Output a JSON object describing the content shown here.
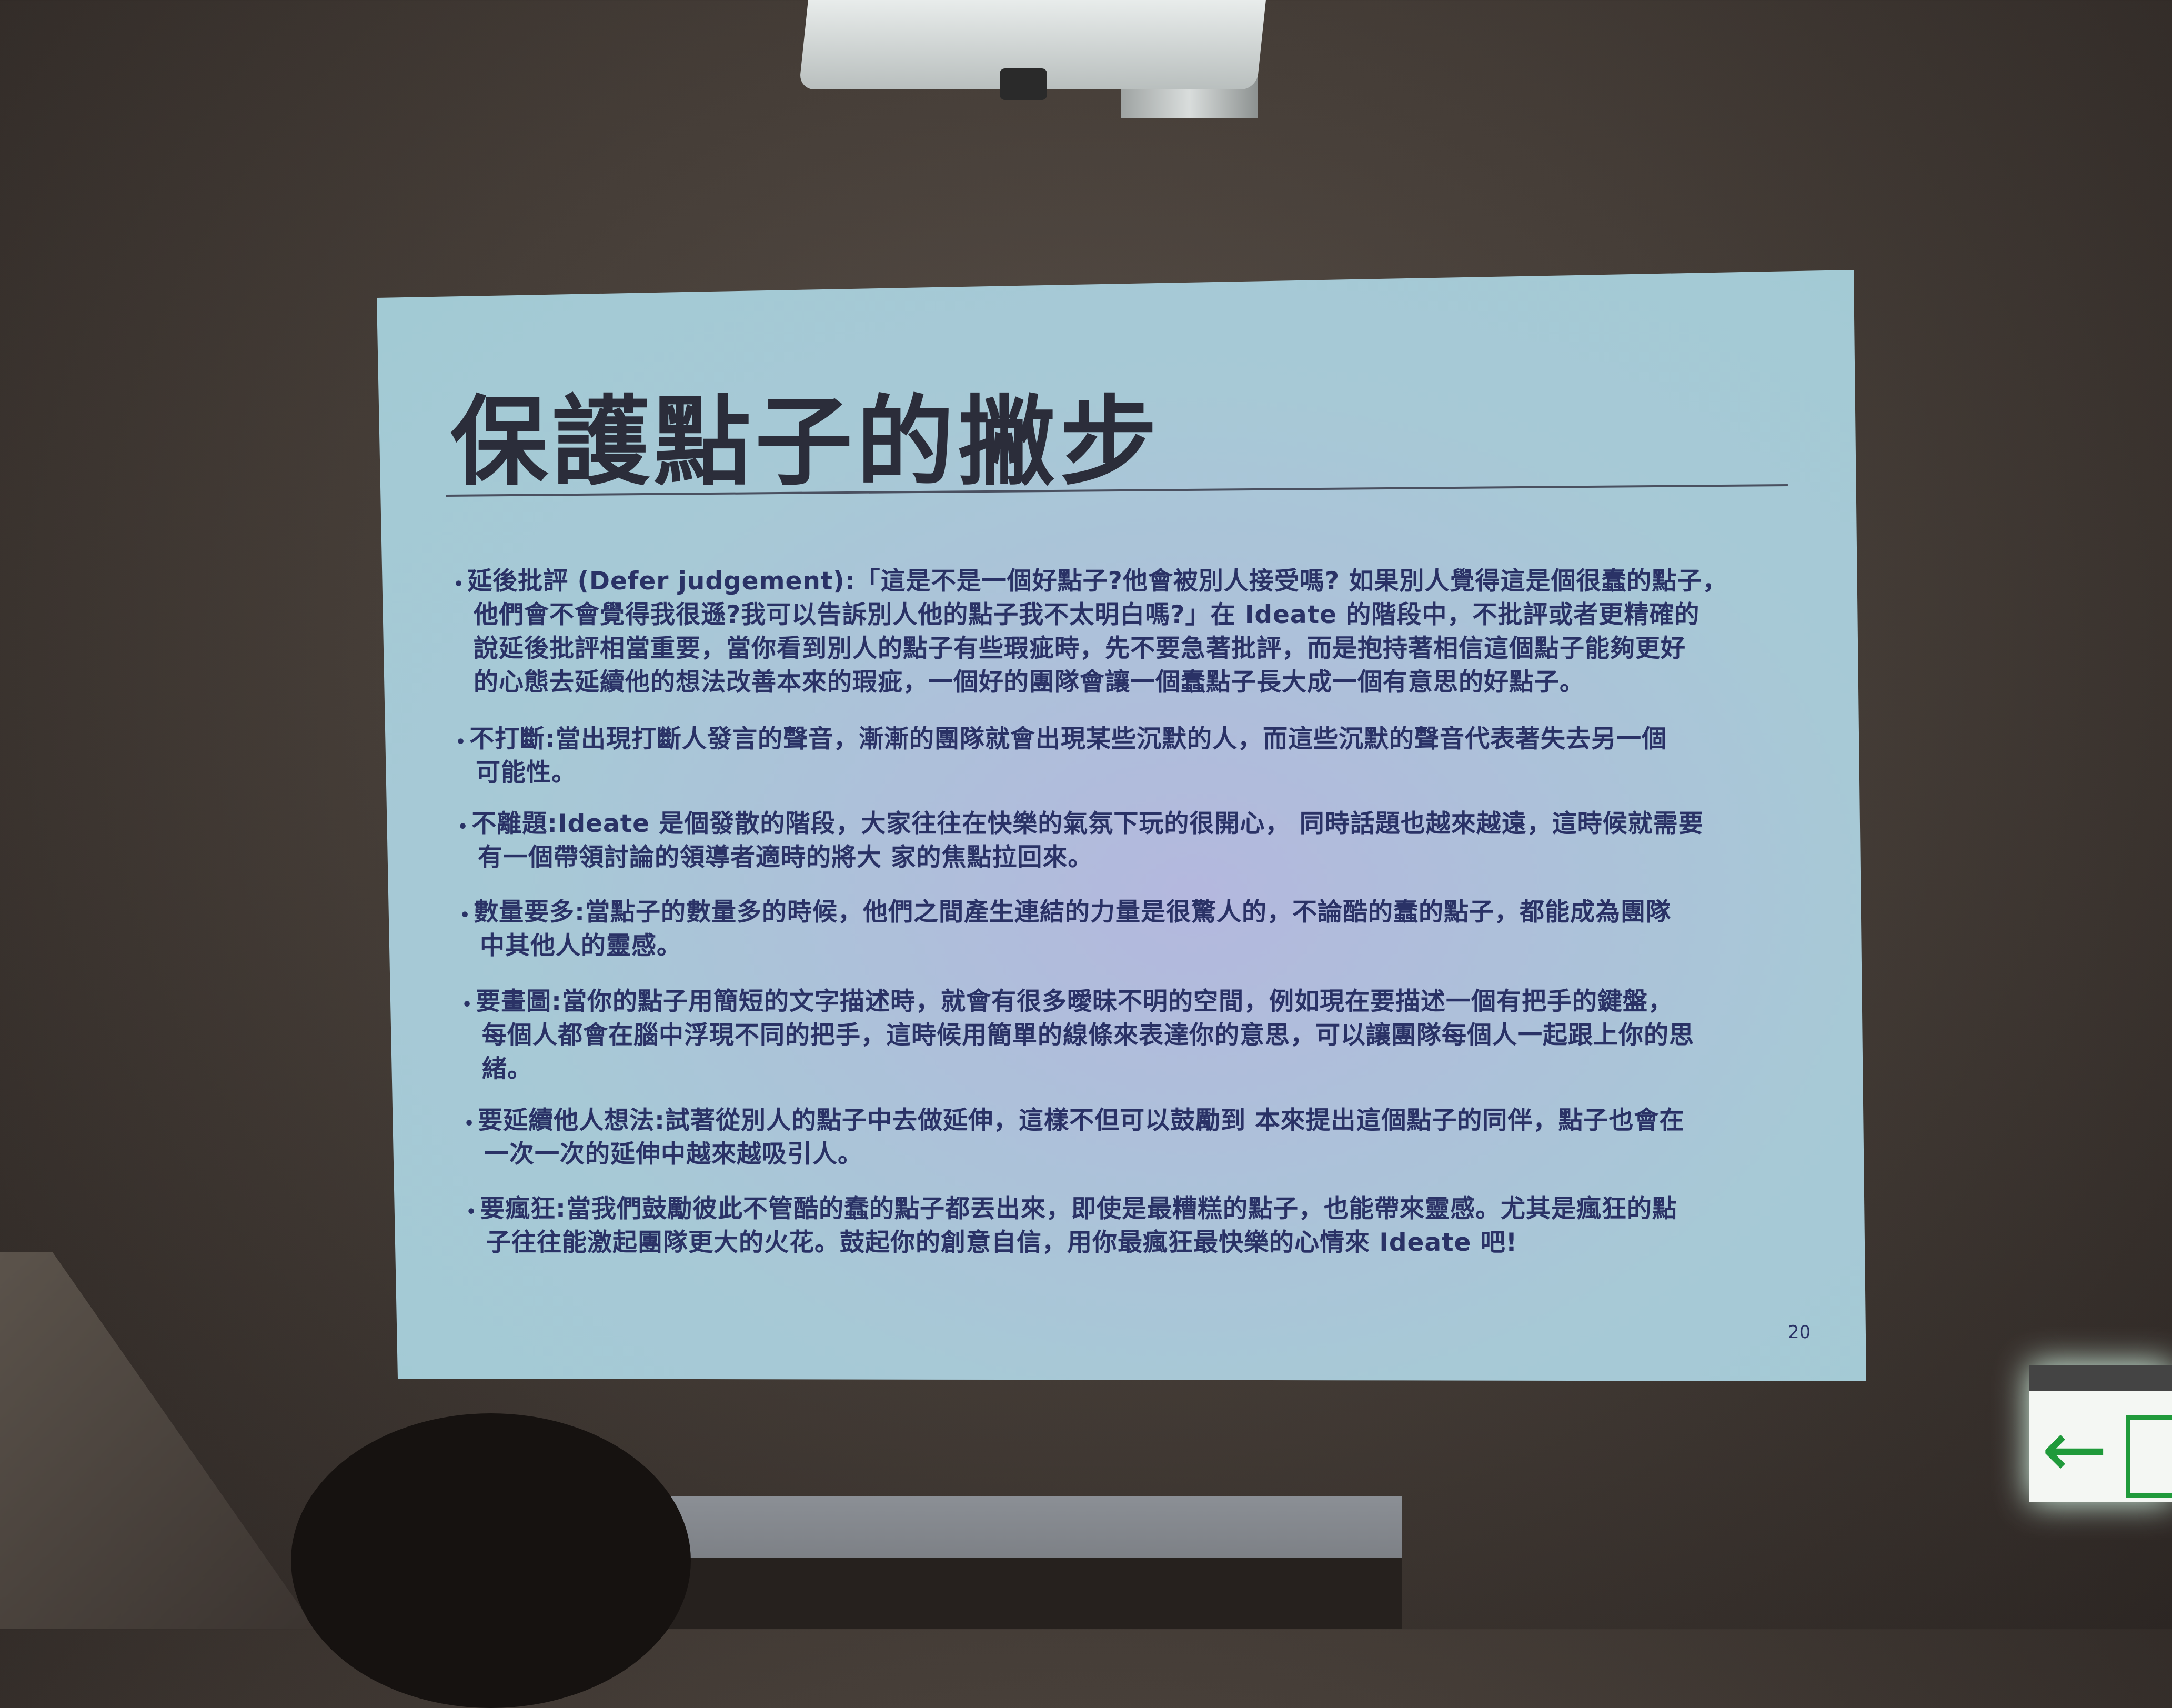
{
  "slide": {
    "title": "保護點子的撇步",
    "page_number": "20",
    "bullets": [
      {
        "lines": [
          "延後批評 (Defer judgement):「這是不是一個好點子?他會被別人接受嗎? 如果別人覺得這是個很蠢的點子，",
          "他們會不會覺得我很遜?我可以告訴別人他的點子我不太明白嗎?」在 Ideate 的階段中，不批評或者更精確的",
          "說延後批評相當重要，當你看到別人的點子有些瑕疵時，先不要急著批評，而是抱持著相信這個點子能夠更好",
          "的心態去延續他的想法改善本來的瑕疵，一個好的團隊會讓一個蠢點子長大成一個有意思的好點子。"
        ]
      },
      {
        "lines": [
          "不打斷:當出現打斷人發言的聲音，漸漸的團隊就會出現某些沉默的人，而這些沉默的聲音代表著失去另一個",
          "可能性。"
        ]
      },
      {
        "lines": [
          "不離題:Ideate 是個發散的階段，大家往往在快樂的氣氛下玩的很開心， 同時話題也越來越遠，這時候就需要",
          "有一個帶領討論的領導者適時的將大 家的焦點拉回來。"
        ]
      },
      {
        "lines": [
          "數量要多:當點子的數量多的時候，他們之間產生連結的力量是很驚人的，不論酷的蠢的點子，都能成為團隊",
          "中其他人的靈感。"
        ]
      },
      {
        "lines": [
          "要畫圖:當你的點子用簡短的文字描述時，就會有很多曖昧不明的空間，例如現在要描述一個有把手的鍵盤，",
          "每個人都會在腦中浮現不同的把手，這時候用簡單的線條來表達你的意思，可以讓團隊每個人一起跟上你的思",
          "緒。"
        ]
      },
      {
        "lines": [
          "要延續他人想法:試著從別人的點子中去做延伸，這樣不但可以鼓勵到 本來提出這個點子的同伴，點子也會在",
          "一次一次的延伸中越來越吸引人。"
        ]
      },
      {
        "lines": [
          "要瘋狂:當我們鼓勵彼此不管酷的蠢的點子都丟出來，即使是最糟糕的點子，也能帶來靈感。尤其是瘋狂的點",
          "子往往能激起團隊更大的火花。鼓起你的創意自信，用你最瘋狂最快樂的心情來 Ideate 吧!"
        ]
      }
    ]
  },
  "colors": {
    "slide_bg": "#a7c9d6",
    "text": "#2a3266",
    "exit_green": "#1f9a3a"
  }
}
